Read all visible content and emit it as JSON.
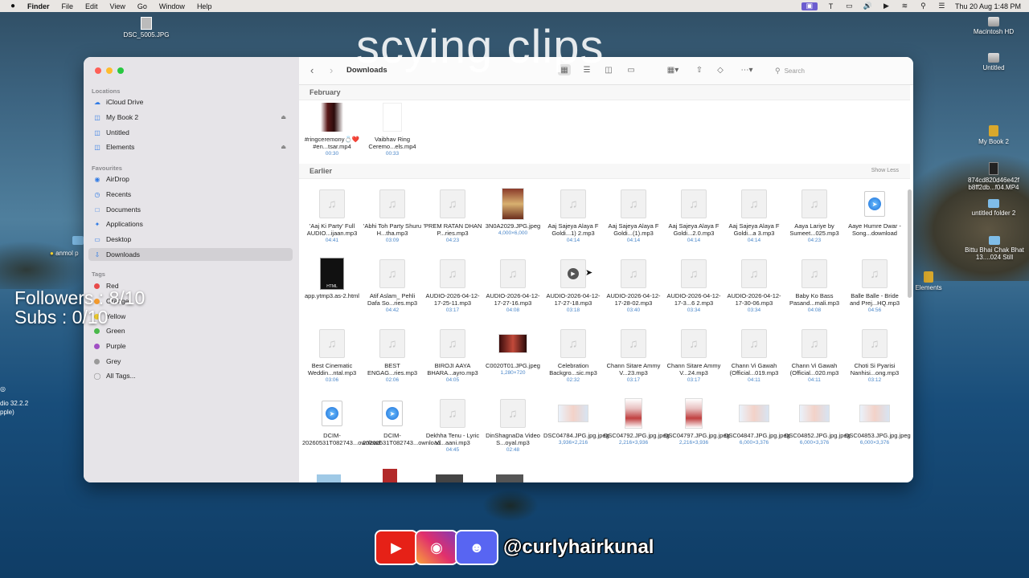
{
  "menubar": {
    "app": "Finder",
    "items": [
      "File",
      "Edit",
      "View",
      "Go",
      "Window",
      "Help"
    ],
    "clock": "Thu 20 Aug  1:48 PM"
  },
  "overlay": {
    "title": "scying clips",
    "followers": "Followers : 8/10",
    "subs": "Subs : 0/10"
  },
  "desktop": {
    "left_icons": [
      "DSC_5005.JPG",
      "anmol p"
    ],
    "left_texts": [
      "dio 32.2.2",
      "pple)"
    ],
    "right_icons": [
      "Macintosh HD",
      "Untitled",
      "My Book 2",
      "874cd820d46e42f b8ff2db...f04.MP4",
      "untitled folder 2",
      "Bittu Bhai Chak Bhat 13....024 Still",
      "Elements"
    ]
  },
  "sidebar": {
    "locations_label": "Locations",
    "locations": [
      "iCloud Drive",
      "My Book 2",
      "Untitled",
      "Elements"
    ],
    "favourites_label": "Favourites",
    "favourites": [
      "AirDrop",
      "Recents",
      "Documents",
      "Applications",
      "Desktop",
      "Downloads"
    ],
    "tags_label": "Tags",
    "tags": [
      {
        "name": "Red",
        "color": "#e84a4a"
      },
      {
        "name": "Orange",
        "color": "#f39a2d"
      },
      {
        "name": "Yellow",
        "color": "#f2cf2e"
      },
      {
        "name": "Green",
        "color": "#49b84a"
      },
      {
        "name": "Purple",
        "color": "#a04fc4"
      },
      {
        "name": "Grey",
        "color": "#9a9a9a"
      },
      {
        "name": "All Tags...",
        "color": ""
      }
    ]
  },
  "toolbar": {
    "title": "Downloads",
    "search_placeholder": "Search"
  },
  "groups": {
    "february": "February",
    "earlier": "Earlier",
    "show_less": "Show Less"
  },
  "feb_files": [
    {
      "name": "#ringceremony💍❤️ #en...tsar.mp4",
      "meta": "00:30"
    },
    {
      "name": "Vaibhav Ring Ceremo...els.mp4",
      "meta": "00:33"
    }
  ],
  "files": [
    {
      "name": "'Aaj Ki Party' Full AUDIO...ijaan.mp3",
      "meta": "04:41",
      "kind": "audio"
    },
    {
      "name": "'Abhi Toh Party Shuru H...tha.mp3",
      "meta": "03:09",
      "kind": "audio"
    },
    {
      "name": "'PREM RATAN DHAN P...ries.mp3",
      "meta": "04:23",
      "kind": "audio"
    },
    {
      "name": "3N0A2029.JPG.jpeg",
      "meta": "4,000×6,000",
      "kind": "photo"
    },
    {
      "name": "Aaj Sajeya  Alaya F  Goldi...1) 2.mp3",
      "meta": "04:14",
      "kind": "audio"
    },
    {
      "name": "Aaj Sajeya  Alaya F  Goldi...(1).mp3",
      "meta": "04:14",
      "kind": "audio"
    },
    {
      "name": "Aaj Sajeya  Alaya F  Goldi...2.0.mp3",
      "meta": "04:14",
      "kind": "audio"
    },
    {
      "name": "Aaj Sajeya  Alaya F  Goldi...a 3.mp3",
      "meta": "04:14",
      "kind": "audio"
    },
    {
      "name": "Aaya Lariye by Sumeet...025.mp3",
      "meta": "04:23",
      "kind": "audio"
    },
    {
      "name": "Aaye Humre Dwar - Song...download",
      "meta": "",
      "kind": "safari"
    },
    {
      "name": "app.ytmp3.as-2.html",
      "meta": "",
      "kind": "html"
    },
    {
      "name": "Atif Aslam_ Pehli Dafa So...ries.mp3",
      "meta": "04:42",
      "kind": "audio"
    },
    {
      "name": "AUDIO-2026-04-12-17-25-11.mp3",
      "meta": "03:17",
      "kind": "audio"
    },
    {
      "name": "AUDIO-2026-04-12-17-27-16.mp3",
      "meta": "04:08",
      "kind": "audio"
    },
    {
      "name": "AUDIO-2026-04-12-17-27-18.mp3",
      "meta": "03:18",
      "kind": "play"
    },
    {
      "name": "AUDIO-2026-04-12-17-28-02.mp3",
      "meta": "03:40",
      "kind": "audio"
    },
    {
      "name": "AUDIO-2026-04-12-17-3...6 2.mp3",
      "meta": "03:34",
      "kind": "audio"
    },
    {
      "name": "AUDIO-2026-04-12-17-30-06.mp3",
      "meta": "03:34",
      "kind": "audio"
    },
    {
      "name": "Baby Ko Bass Pasand...mali.mp3",
      "meta": "04:08",
      "kind": "audio"
    },
    {
      "name": "Balle Balle - Bride and Prej...HQ.mp3",
      "meta": "04:56",
      "kind": "audio"
    },
    {
      "name": "Best Cinematic Weddin...ntal.mp3",
      "meta": "03:06",
      "kind": "audio"
    },
    {
      "name": "BEST ENGAG...ries.mp3",
      "meta": "02:06",
      "kind": "audio"
    },
    {
      "name": "BIROJI AAYA BHARA...ayro.mp3",
      "meta": "04:05",
      "kind": "audio"
    },
    {
      "name": "C0020T01.JPG.jpeg",
      "meta": "1,280×720",
      "kind": "photo-wide"
    },
    {
      "name": "Celebration Backgro...sic.mp3",
      "meta": "02:32",
      "kind": "audio"
    },
    {
      "name": "Chann Sitare Ammy V...23.mp3",
      "meta": "03:17",
      "kind": "audio"
    },
    {
      "name": "Chann Sitare Ammy V...24.mp3",
      "meta": "03:17",
      "kind": "audio"
    },
    {
      "name": "Chann Vi Gawah (Official...019.mp3",
      "meta": "04:11",
      "kind": "audio"
    },
    {
      "name": "Chann Vi Gawah (Official...020.mp3",
      "meta": "04:11",
      "kind": "audio"
    },
    {
      "name": "Choti Si Pyarisi Nanhisi...ong.mp3",
      "meta": "03:12",
      "kind": "audio"
    },
    {
      "name": "DCIM-20260531T082743...ownload",
      "meta": "",
      "kind": "safari"
    },
    {
      "name": "DCIM-20260531T082743...ownload",
      "meta": "",
      "kind": "safari"
    },
    {
      "name": "Dekhha Tenu - Lyric Vi...aani.mp3",
      "meta": "04:45",
      "kind": "audio"
    },
    {
      "name": "DinShagnaDa Video S...oyal.mp3",
      "meta": "02:48",
      "kind": "audio"
    },
    {
      "name": "DSC04784.JPG.jpg.jpeg",
      "meta": "3,936×2,216",
      "kind": "photo-baby"
    },
    {
      "name": "DSC04792.JPG.jpg.jpeg",
      "meta": "2,216×3,936",
      "kind": "photo-tall"
    },
    {
      "name": "DSC04797.JPG.jpg.jpeg",
      "meta": "2,216×3,936",
      "kind": "photo-tall"
    },
    {
      "name": "DSC04847.JPG.jpg.jpeg",
      "meta": "6,000×3,376",
      "kind": "photo-baby"
    },
    {
      "name": "DSC04852.JPG.jpg.jpeg",
      "meta": "6,000×3,376",
      "kind": "photo-baby"
    },
    {
      "name": "DSC04853.JPG.jpg.jpeg",
      "meta": "6,000×3,376",
      "kind": "photo-baby"
    }
  ],
  "social": {
    "handle": "@curlyhairkunal",
    "icons": [
      "youtube-icon",
      "instagram-icon",
      "discord-icon"
    ]
  }
}
